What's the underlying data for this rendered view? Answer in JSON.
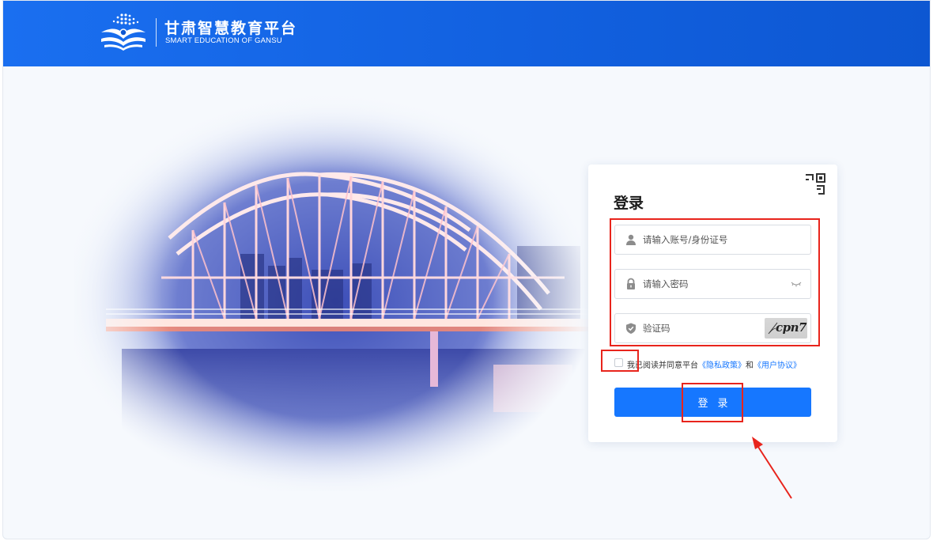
{
  "header": {
    "title_cn": "甘肃智慧教育平台",
    "title_en": "SMART EDUCATION OF GANSU",
    "color": "#1565e5"
  },
  "login": {
    "title": "登录",
    "account_placeholder": "请输入账号/身份证号",
    "password_placeholder": "请输入密码",
    "captcha_placeholder": "验证码",
    "captcha_text": "cpn7",
    "agree_prefix": "我已阅读并同意平台",
    "privacy_link": "《隐私政策》",
    "agree_and": "和",
    "terms_link": "《用户协议》",
    "button_label": "登录",
    "button_color": "#1677ff"
  },
  "icons": {
    "qr": "qr-code-icon",
    "user": "user-icon",
    "lock": "lock-icon",
    "eye": "eye-closed-icon",
    "shield": "shield-icon"
  },
  "annotation_color": "#e8241c"
}
